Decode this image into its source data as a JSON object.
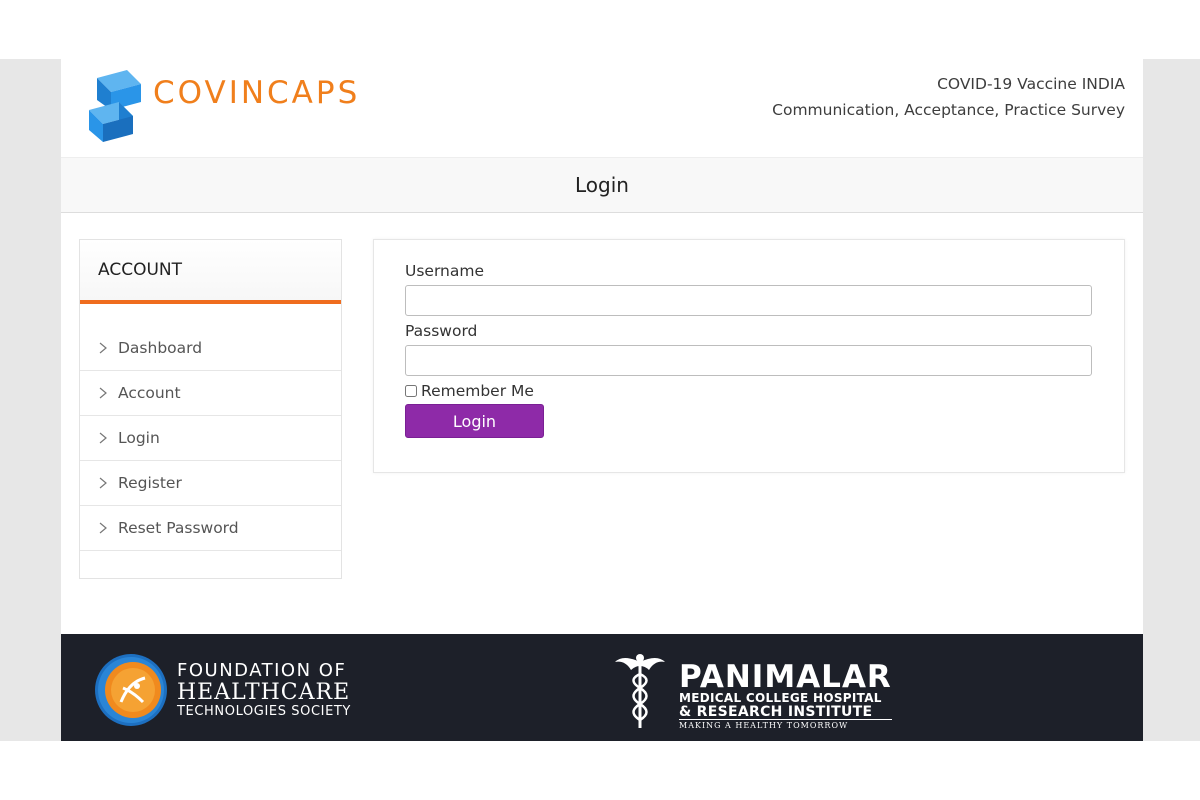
{
  "header": {
    "brand": "COVINCAPS",
    "tagline_line1": "COVID-19 Vaccine INDIA",
    "tagline_line2": "Communication, Acceptance, Practice Survey"
  },
  "page_title": "Login",
  "sidebar": {
    "heading": "ACCOUNT",
    "items": [
      {
        "label": "Dashboard"
      },
      {
        "label": "Account"
      },
      {
        "label": "Login"
      },
      {
        "label": "Register"
      },
      {
        "label": "Reset Password"
      }
    ]
  },
  "form": {
    "username_label": "Username",
    "username_value": "",
    "password_label": "Password",
    "password_value": "",
    "remember_label": "Remember Me",
    "remember_checked": false,
    "submit_label": "Login"
  },
  "footer": {
    "org1_line1": "FOUNDATION OF",
    "org1_line2": "HEALTHCARE",
    "org1_line3": "TECHNOLOGIES SOCIETY",
    "org2_line1": "PANIMALAR",
    "org2_line2": "MEDICAL COLLEGE HOSPITAL",
    "org2_line3": "& RESEARCH INSTITUTE",
    "org2_line4": "MAKING A HEALTHY TOMORROW"
  },
  "colors": {
    "brand_orange": "#f07f1c",
    "accent_purple": "#8e2aa8",
    "logo_blue": "#1f8fe0",
    "footer_bg": "#1d2029"
  }
}
